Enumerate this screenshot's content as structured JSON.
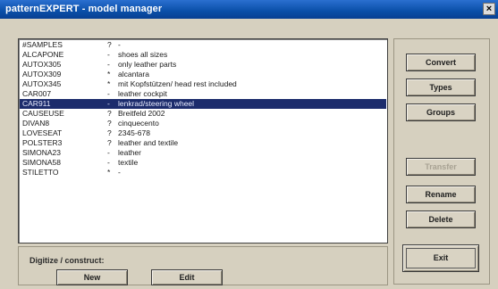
{
  "window": {
    "title": "patternEXPERT - model manager",
    "close_glyph": "×"
  },
  "list": [
    {
      "name": "#SAMPLES",
      "flag": "?",
      "desc": "-"
    },
    {
      "name": "ALCAPONE",
      "flag": "-",
      "desc": "shoes all sizes"
    },
    {
      "name": "AUTOX305",
      "flag": "-",
      "desc": "only leather parts"
    },
    {
      "name": "AUTOX309",
      "flag": "*",
      "desc": "alcantara"
    },
    {
      "name": "AUTOX345",
      "flag": "*",
      "desc": "mit Kopfstützen/ head rest included"
    },
    {
      "name": "CAR007",
      "flag": "-",
      "desc": "leather cockpit"
    },
    {
      "name": "CAR911",
      "flag": "-",
      "desc": "lenkrad/steering wheel"
    },
    {
      "name": "CAUSEUSE",
      "flag": "?",
      "desc": "Breitfeld 2002"
    },
    {
      "name": "DIVAN8",
      "flag": "?",
      "desc": "cinquecento"
    },
    {
      "name": "LOVESEAT",
      "flag": "?",
      "desc": "2345-678"
    },
    {
      "name": "POLSTER3",
      "flag": "?",
      "desc": "leather and textile"
    },
    {
      "name": "SIMONA23",
      "flag": "-",
      "desc": "leather"
    },
    {
      "name": "SIMONA58",
      "flag": "-",
      "desc": "textile"
    },
    {
      "name": "STILETTO",
      "flag": "*",
      "desc": "-"
    }
  ],
  "selected_index": 6,
  "digitize": {
    "label": "Digitize / construct:",
    "new_label": "New",
    "edit_label": "Edit"
  },
  "side_buttons": {
    "convert": "Convert",
    "types": "Types",
    "groups": "Groups",
    "transfer": "Transfer",
    "rename": "Rename",
    "delete": "Delete",
    "exit": "Exit"
  },
  "colors": {
    "titlebar": "#0a4fa8",
    "selection": "#1c2c6c",
    "dialog": "#d6d0bf"
  }
}
